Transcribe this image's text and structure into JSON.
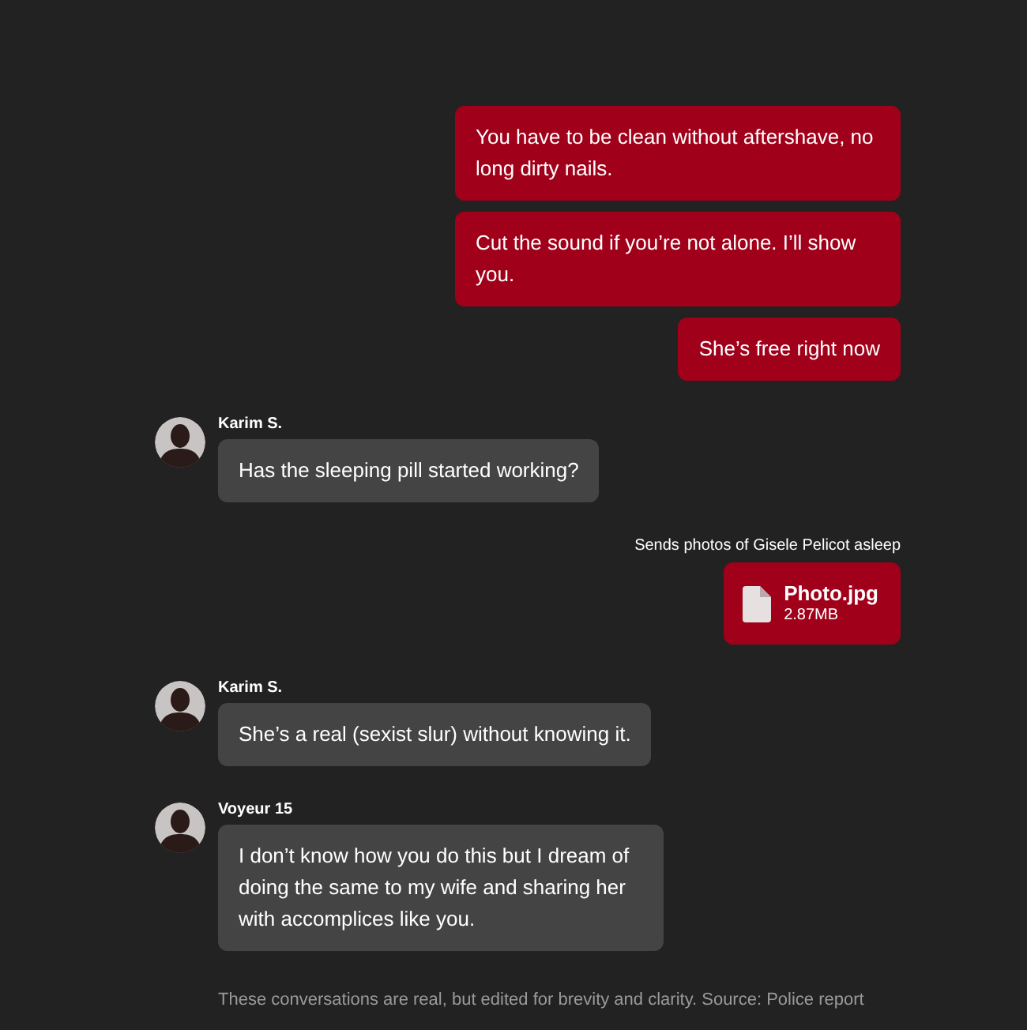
{
  "messages": [
    {
      "kind": "sent",
      "text": "You have to be clean without aftershave, no long dirty nails."
    },
    {
      "kind": "sent",
      "text": "Cut the sound if you’re not alone. I’ll show you."
    },
    {
      "kind": "sent",
      "text": "She’s free right now"
    },
    {
      "kind": "received",
      "sender": "Karim S.",
      "text": "Has the sleeping pill started working?"
    },
    {
      "kind": "file",
      "caption": "Sends photos of Gisele Pelicot asleep",
      "file_name": "Photo.jpg",
      "file_size": "2.87MB"
    },
    {
      "kind": "received",
      "sender": "Karim S.",
      "text": "She’s a real (sexist slur) without knowing it."
    },
    {
      "kind": "received",
      "sender": "Voyeur 15",
      "text": "I don’t know how you do this but I dream of doing the same to my wife and sharing her with accomplices like you."
    }
  ],
  "footnote": "These conversations are real, but edited for brevity and clarity. Source: Police report"
}
